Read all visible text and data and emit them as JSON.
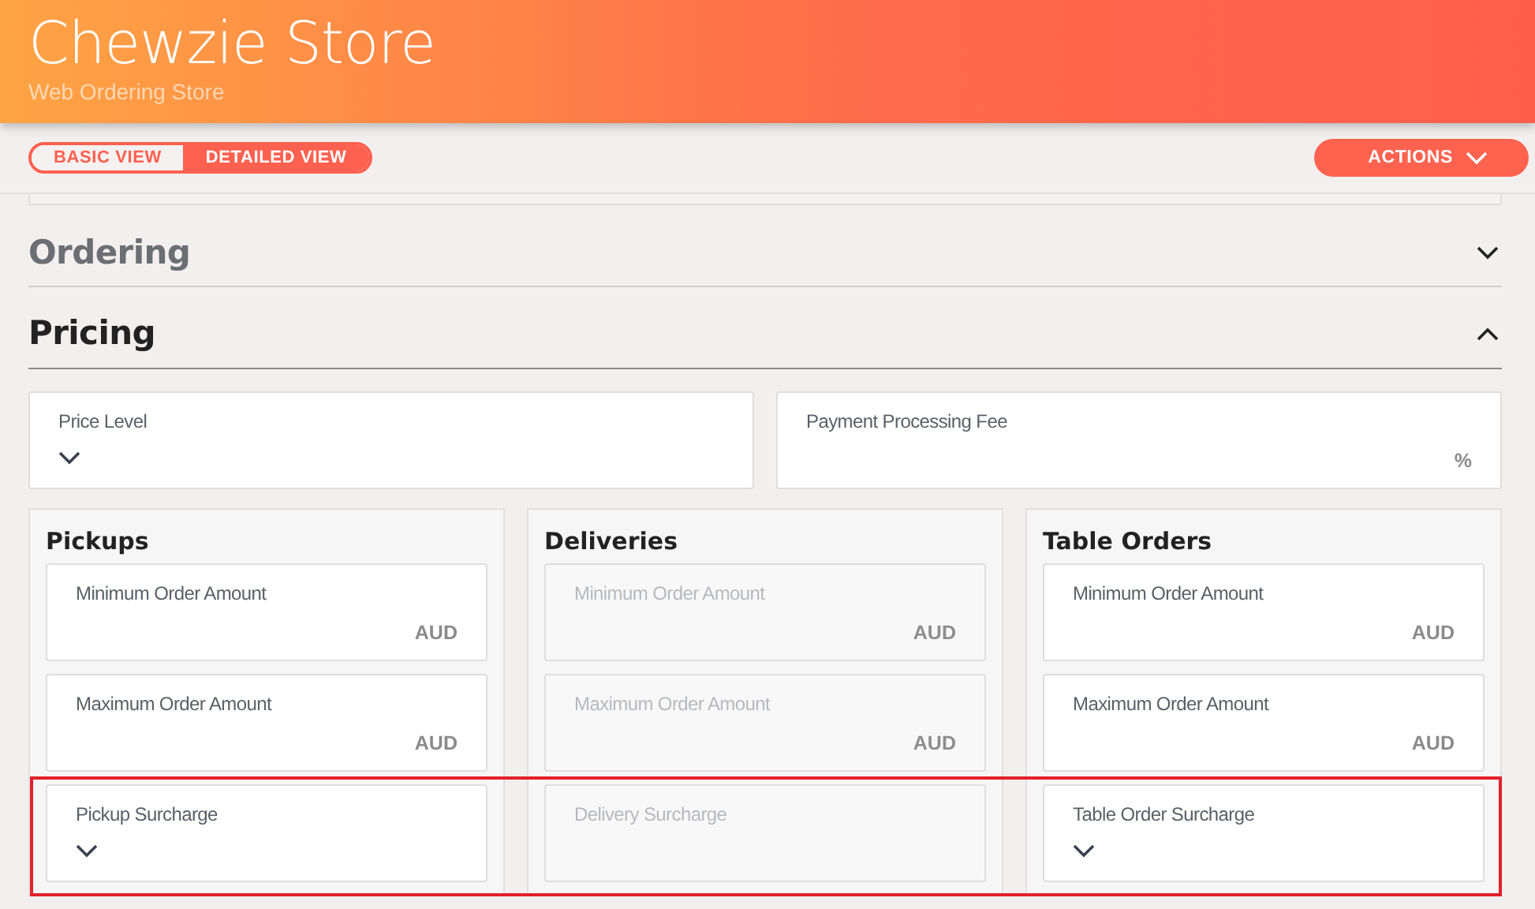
{
  "header": {
    "title": "Chewzie Store",
    "subtitle": "Web Ordering Store"
  },
  "view_toggle": [
    {
      "label": "BASIC VIEW",
      "selected": false
    },
    {
      "label": "DETAILED VIEW",
      "selected": true
    }
  ],
  "actions_button": {
    "label": "ACTIONS"
  },
  "sections": [
    {
      "title": "Ordering",
      "expanded": false
    },
    {
      "title": "Pricing",
      "expanded": true
    }
  ],
  "pricing_fields": [
    {
      "kind": "select",
      "label": "Price Level",
      "disabled": false
    },
    {
      "kind": "amount",
      "label": "Payment Processing Fee",
      "unit": "%",
      "disabled": false
    }
  ],
  "columns": [
    {
      "title": "Pickups",
      "fields": [
        {
          "kind": "amount",
          "label": "Minimum Order Amount",
          "unit": "AUD",
          "disabled": false
        },
        {
          "kind": "amount",
          "label": "Maximum Order Amount",
          "unit": "AUD",
          "disabled": false
        },
        {
          "kind": "select",
          "label": "Pickup Surcharge",
          "disabled": false
        }
      ]
    },
    {
      "title": "Deliveries",
      "fields": [
        {
          "kind": "amount",
          "label": "Minimum Order Amount",
          "unit": "AUD",
          "disabled": true
        },
        {
          "kind": "amount",
          "label": "Maximum Order Amount",
          "unit": "AUD",
          "disabled": true
        },
        {
          "kind": "select",
          "label": "Delivery Surcharge",
          "disabled": true
        }
      ]
    },
    {
      "title": "Table Orders",
      "fields": [
        {
          "kind": "amount",
          "label": "Minimum Order Amount",
          "unit": "AUD",
          "disabled": false
        },
        {
          "kind": "amount",
          "label": "Maximum Order Amount",
          "unit": "AUD",
          "disabled": false
        },
        {
          "kind": "select",
          "label": "Table Order Surcharge",
          "disabled": false
        }
      ]
    }
  ]
}
